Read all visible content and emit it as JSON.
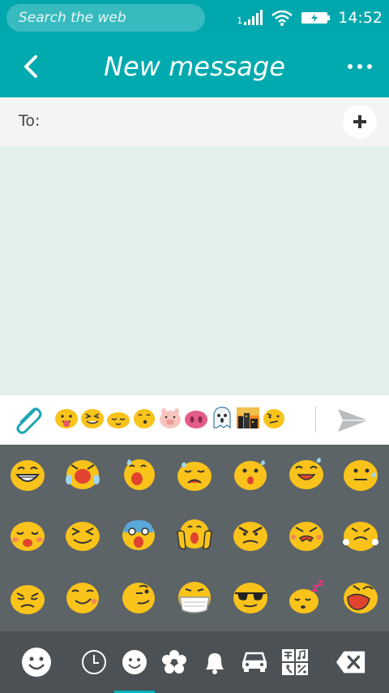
{
  "statusbar": {
    "search_placeholder": "Search the web",
    "sim_number": "1",
    "time": "14:52"
  },
  "header": {
    "title": "New message"
  },
  "recipient": {
    "to_label": "To:"
  },
  "composer": {
    "suggested_emojis": [
      "tongue-out",
      "squint-tongue",
      "relieved",
      "kissing",
      "pig-face",
      "pig-nose",
      "ghost",
      "night-city",
      "confused"
    ]
  },
  "emoji_grid": [
    [
      "grinning",
      "crying-laughing",
      "sweat-smile",
      "sad-sweat",
      "surprised-sweat",
      "laughing-sweat",
      "neutral-sweat"
    ],
    [
      "persevering",
      "squinting",
      "screaming-fear",
      "scream-hands",
      "angry",
      "pouting",
      "fuming"
    ],
    [
      "disappointed",
      "smirking",
      "winking",
      "mask",
      "sunglasses",
      "sleeping",
      "tired-yelling"
    ]
  ],
  "colors": {
    "accent": "#00aaae",
    "emoji_yellow": "#f9c31b",
    "pad_bg": "#5d6467",
    "tabbar_bg": "#4b5154",
    "indicator": "#00b4c0"
  },
  "tabs": [
    "smiley-toggle",
    "recent",
    "smileys",
    "flowers",
    "bell",
    "vehicles",
    "symbols",
    "backspace"
  ],
  "active_tab": "smileys"
}
